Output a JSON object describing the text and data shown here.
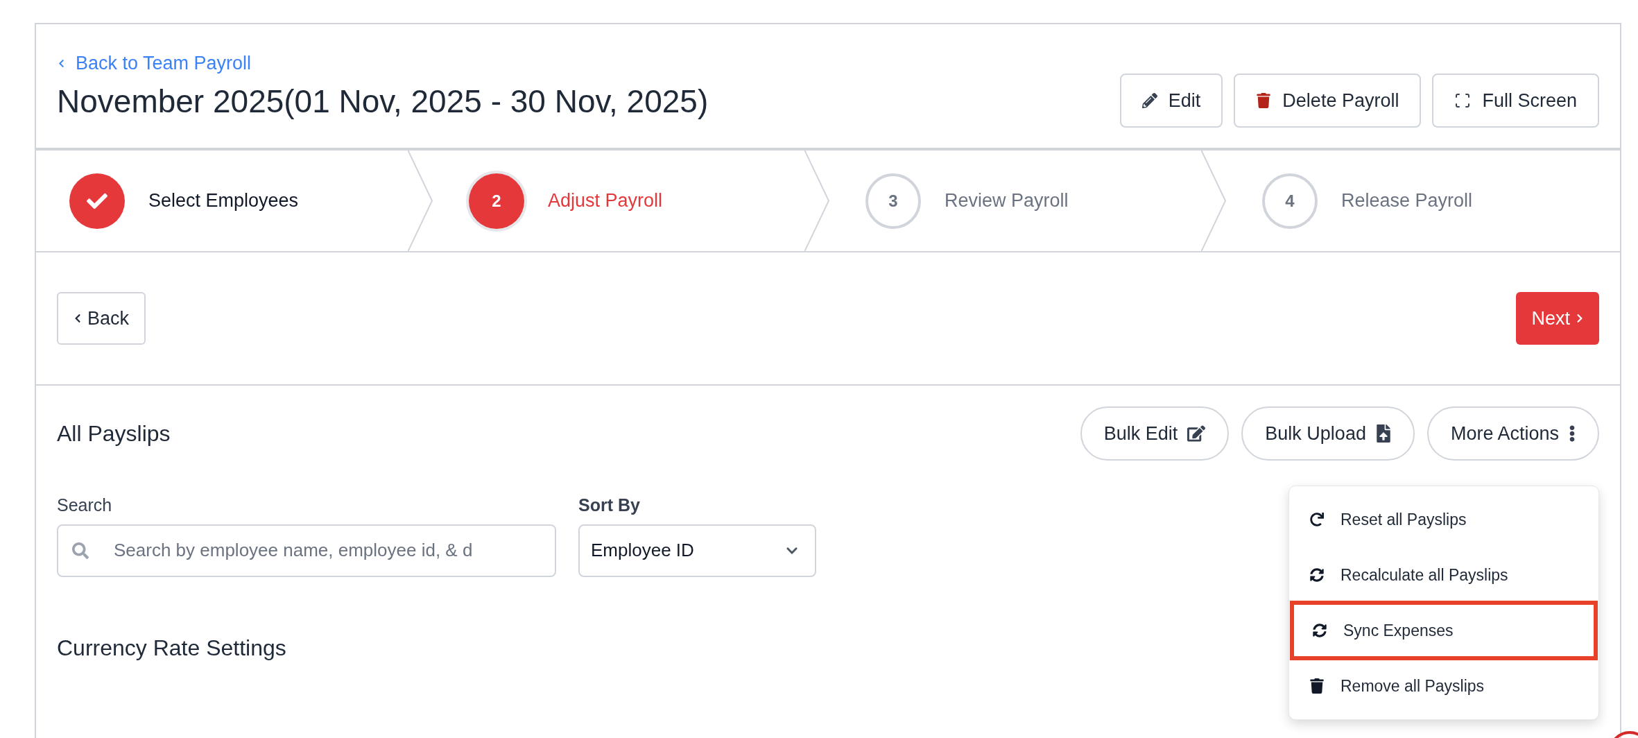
{
  "header": {
    "back_link": "Back to Team Payroll",
    "title": "November 2025(01 Nov, 2025 - 30 Nov, 2025)",
    "buttons": [
      {
        "kind": "edit",
        "label": "Edit"
      },
      {
        "kind": "delete",
        "label": "Delete Payroll"
      },
      {
        "kind": "fullscreen",
        "label": "Full Screen"
      }
    ]
  },
  "steps": [
    {
      "label": "Select Employees",
      "done": true,
      "selected": false
    },
    {
      "number": "2",
      "label": "Adjust Payroll",
      "done": false,
      "selected": true
    },
    {
      "number": "3",
      "label": "Review Payroll",
      "done": false,
      "selected": false
    },
    {
      "number": "4",
      "label": "Release Payroll",
      "done": false,
      "selected": false
    }
  ],
  "nav": {
    "back": "Back",
    "next": "Next"
  },
  "payslips": {
    "title": "All Payslips",
    "actions": [
      {
        "kind": "edit",
        "label": "Bulk Edit"
      },
      {
        "kind": "upload",
        "label": "Bulk Upload"
      },
      {
        "kind": "more",
        "label": "More Actions"
      }
    ],
    "search": {
      "label": "Search",
      "placeholder": "Search by employee name, employee id, & d"
    },
    "sort": {
      "label": "Sort By",
      "value": "Employee ID"
    },
    "menu": [
      {
        "kind": "reset",
        "label": "Reset all Payslips",
        "highlighted": false
      },
      {
        "kind": "sync",
        "label": "Recalculate all Payslips",
        "highlighted": false
      },
      {
        "kind": "sync",
        "label": "Sync Expenses",
        "highlighted": true
      },
      {
        "kind": "delete",
        "label": "Remove all Payslips",
        "highlighted": false
      }
    ]
  },
  "currency": {
    "title": "Currency Rate Settings"
  }
}
